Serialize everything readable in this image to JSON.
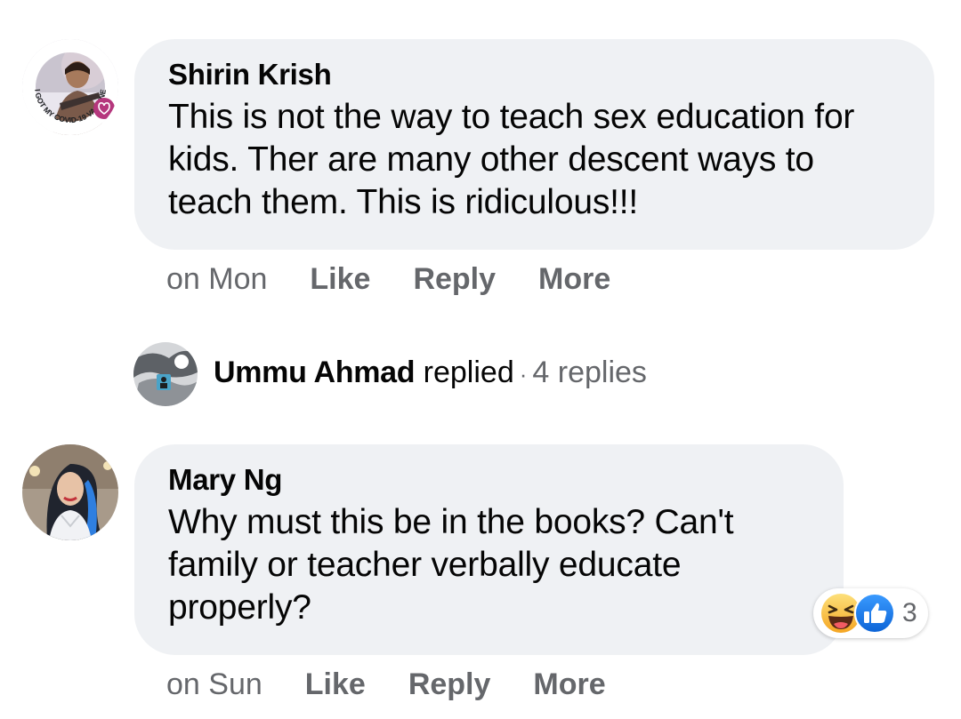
{
  "comments": [
    {
      "author": "Shirin Krish",
      "text": "This is not the way to teach sex education for kids. Ther are many other descent ways to teach them. This is ridiculous!!!",
      "avatar_badge": "I GOT MY COVID-19 VACCINE",
      "time": "on Mon",
      "like_label": "Like",
      "reply_label": "Reply",
      "more_label": "More"
    },
    {
      "author": "Mary Ng",
      "text": "Why must this be in the books? Can't family or teacher verbally educate properly?",
      "time": "on Sun",
      "like_label": "Like",
      "reply_label": "Reply",
      "more_label": "More",
      "reactions": {
        "icons": [
          "haha-icon",
          "like-icon"
        ],
        "count": "3"
      }
    }
  ],
  "replies": {
    "name": "Ummu Ahmad",
    "verb": "replied",
    "separator": "·",
    "count_label": "4 replies"
  },
  "colors": {
    "bubble": "#eff1f4",
    "secondary_text": "#65676b",
    "primary_text": "#050505",
    "like_blue": "#1877f2",
    "haha_yellow": "#f7b125"
  }
}
